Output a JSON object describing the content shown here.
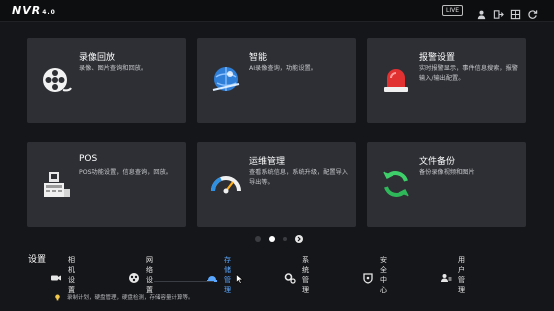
{
  "topbar": {
    "logo_text": "NVR",
    "logo_version": "4.0",
    "live_label": "LIVE",
    "icons": [
      "user-icon",
      "exit-icon",
      "grid-icon",
      "refresh-icon"
    ]
  },
  "cards": [
    {
      "id": "playback",
      "title": "录像回放",
      "desc": "录像、图片查询和回放。",
      "icon": "film-reel-icon"
    },
    {
      "id": "smart",
      "title": "智能",
      "desc": "AI录像查询，功能设置。",
      "icon": "ai-globe-icon"
    },
    {
      "id": "alarm",
      "title": "报警设置",
      "desc": "实时报警显示，事件信息搜索，报警输入/输出配置。",
      "icon": "siren-icon"
    },
    {
      "id": "pos",
      "title": "POS",
      "desc": "POS功能设置，信息查询，回放。",
      "icon": "pos-terminal-icon"
    },
    {
      "id": "maintenance",
      "title": "运维管理",
      "desc": "查看系统信息，系统升级，配置导入导出等。",
      "icon": "gauge-icon"
    },
    {
      "id": "backup",
      "title": "文件备份",
      "desc": "备份录像视频和图片",
      "icon": "sync-icon"
    }
  ],
  "pager": {
    "dots": 4,
    "active_index": 1
  },
  "settings": {
    "title": "设置",
    "items": [
      {
        "label": "相机设置",
        "icon": "camera-icon"
      },
      {
        "label": "网络设置",
        "icon": "network-icon"
      },
      {
        "label": "存储管理",
        "icon": "storage-icon",
        "active": true
      },
      {
        "label": "系统管理",
        "icon": "gears-icon"
      },
      {
        "label": "安全中心",
        "icon": "shield-icon"
      },
      {
        "label": "用户管理",
        "icon": "users-icon"
      }
    ],
    "tip": "录制计划，硬盘管理，硬盘检测，存储容量计算等。"
  },
  "colors": {
    "accent": "#5aa7ff",
    "card_bg": "#2d2f34",
    "page_bg": "#151619"
  }
}
